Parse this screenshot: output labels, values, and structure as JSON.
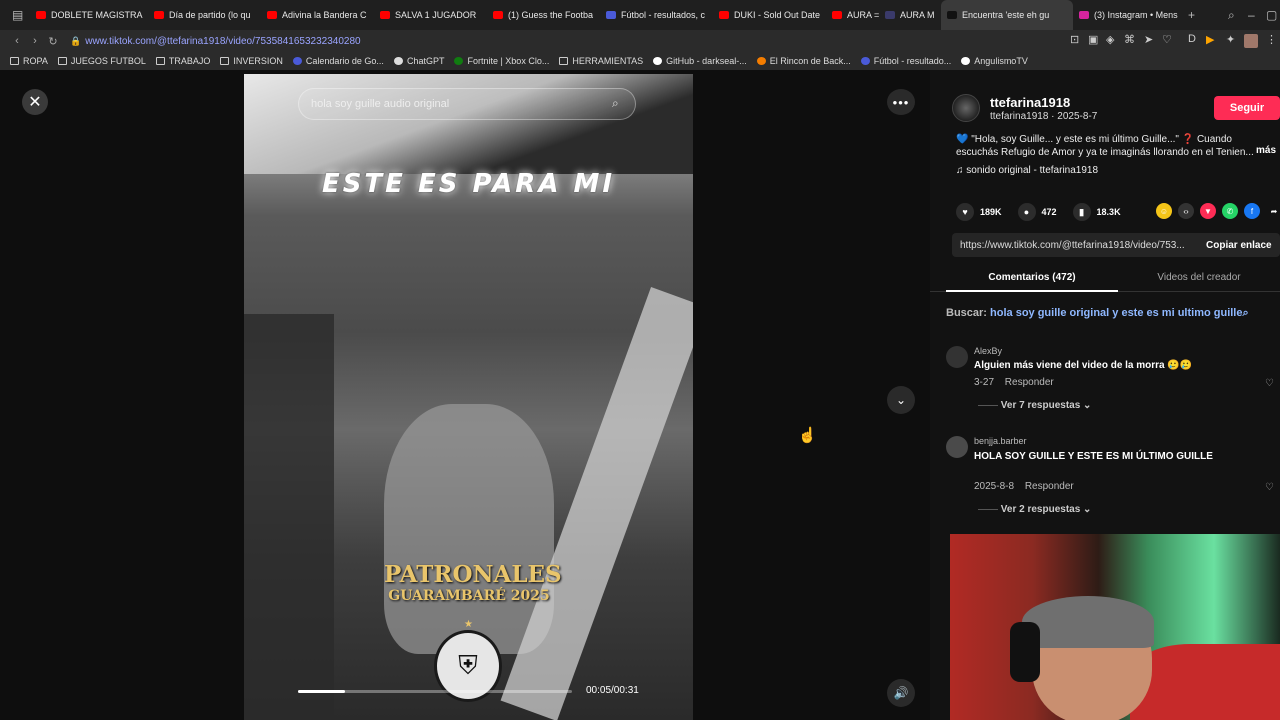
{
  "browser": {
    "tabs": [
      {
        "label": "DOBLETE MAGISTRA",
        "color": "#ff0000"
      },
      {
        "label": "Día de partido (lo qu",
        "color": "#ff0000"
      },
      {
        "label": "Adivina la Bandera C",
        "color": "#ff0000"
      },
      {
        "label": "SALVA 1 JUGADOR",
        "color": "#ff0000"
      },
      {
        "label": "(1) Guess the Footba",
        "color": "#ff0000"
      },
      {
        "label": "Fútbol - resultados, c",
        "color": "#4a5ad8"
      },
      {
        "label": "DUKI - Sold Out Date",
        "color": "#ff0000"
      },
      {
        "label": "AURA =",
        "color": "#ff0000"
      },
      {
        "label": "AURA M",
        "color": "#3a3a6a"
      },
      {
        "label": "Encuentra 'este eh gu",
        "color": "#111111",
        "active": true
      },
      {
        "label": "(3) Instagram • Mens",
        "color": "#d6249f"
      }
    ],
    "url": "www.tiktok.com/@ttefarina1918/video/7535841653232340280",
    "bookmarks": [
      {
        "label": "ROPA",
        "icon": "folder-icon"
      },
      {
        "label": "JUEGOS FUTBOL",
        "icon": "folder-icon"
      },
      {
        "label": "TRABAJO",
        "icon": "folder-icon"
      },
      {
        "label": "INVERSION",
        "icon": "folder-icon"
      },
      {
        "label": "Calendario de Go...",
        "icon": "calendar-icon"
      },
      {
        "label": "ChatGPT",
        "icon": "chatgpt-icon"
      },
      {
        "label": "Fortnite | Xbox Clo...",
        "icon": "xbox-icon"
      },
      {
        "label": "HERRAMIENTAS",
        "icon": "folder-icon"
      },
      {
        "label": "GitHub - darkseal-...",
        "icon": "github-icon"
      },
      {
        "label": "El Rincon de Back...",
        "icon": "blogger-icon"
      },
      {
        "label": "Fútbol - resultado...",
        "icon": "flashscore-icon"
      },
      {
        "label": "AngulismoTV",
        "icon": "angulismo-icon"
      }
    ]
  },
  "video": {
    "search_text": "hola soy guille audio original",
    "caption": "ESTE ES PARA MI",
    "patronales_line1": "PATRONALES",
    "patronales_line2": "GUARAMBARÉ 2025",
    "crest_text": "CLUB Tte. JOSÉ M. FARIÑA · GUARAMBARÉ",
    "time": "00:05/00:31",
    "progress": 0.17
  },
  "panel": {
    "author": "ttefarina1918",
    "author_sub": "ttefarina1918 · 2025-8-7",
    "follow_label": "Seguir",
    "description": "💙 \"Hola, soy Guille... y este es mi último Guille...\" ❓ Cuando escuchás Refugio de Amor y ya te imaginás llorando en el Tenien...",
    "more_label": "más",
    "sound": "sonido original - ttefarina1918",
    "likes": "189K",
    "comments": "472",
    "saves": "18.3K",
    "link": "https://www.tiktok.com/@ttefarina1918/video/753...",
    "copy_label": "Copiar enlace",
    "tab_comments": "Comentarios (472)",
    "tab_videos": "Videos del creador",
    "search_prefix": "Buscar:",
    "search_query": "hola soy guille original y este es mi ultimo guille",
    "comments_list": [
      {
        "user": "AlexBy",
        "text": "Alguien más viene del video de la morra 🥲🥲",
        "date": "3-27",
        "reply": "Responder",
        "replies": "Ver 7 respuestas"
      },
      {
        "user": "benjja.barber",
        "text": "HOLA SOY GUILLE Y ESTE ES MI ÚLTIMO GUILLE",
        "date": "2025-8-8",
        "reply": "Responder",
        "replies": "Ver 2 respuestas"
      }
    ]
  }
}
